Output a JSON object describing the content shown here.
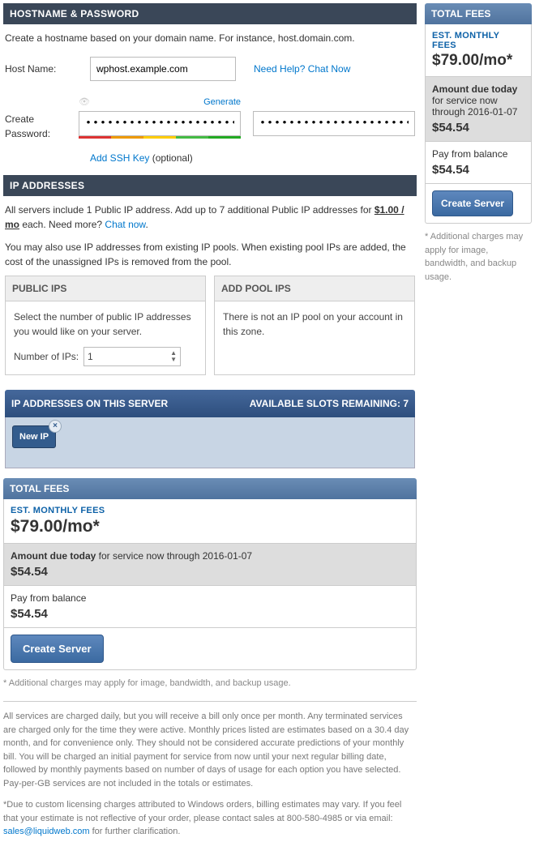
{
  "hostname_section": {
    "header": "HOSTNAME & PASSWORD",
    "intro": "Create a hostname based on your domain name. For instance, host.domain.com.",
    "host_label": "Host Name:",
    "host_value": "wphost.example.com",
    "need_help": "Need Help? Chat Now",
    "pw_label": "Create Password:",
    "generate": "Generate",
    "pw_value": "••••••••••••••••••••••••••",
    "pw_confirm_value": "••••••••••••••••••••••••••",
    "add_ssh": "Add SSH Key",
    "add_ssh_optional": " (optional)"
  },
  "ip_section": {
    "header": "IP ADDRESSES",
    "line1_a": "All servers include 1 Public IP address. Add up to 7 additional Public IP addresses for ",
    "line1_price": "$1.00 / mo",
    "line1_b": " each. Need more? ",
    "chat_now": "Chat now",
    "line2": "You may also use IP addresses from existing IP pools. When existing pool IPs are added, the cost of the unassigned IPs is removed from the pool.",
    "public_ips_head": "PUBLIC IPS",
    "public_ips_text": "Select the number of public IP addresses you would like on your server.",
    "num_ips_label": "Number of IPs:",
    "num_ips_value": "1",
    "pool_ips_head": "ADD POOL IPS",
    "pool_ips_text": "There is not an IP pool on your account in this zone.",
    "server_ips_head": "IP ADDRESSES ON THIS SERVER",
    "slots_remaining": "AVAILABLE SLOTS REMAINING: 7",
    "new_ip_chip": "New IP"
  },
  "fees": {
    "header": "TOTAL FEES",
    "est_label": "EST. MONTHLY FEES",
    "est_price": "$79.00/mo*",
    "due_label_a": "Amount due today",
    "due_label_b": " for service now through 2016-01-07",
    "due_amount": "$54.54",
    "pay_label": "Pay from balance",
    "pay_amount": "$54.54",
    "create_btn": "Create Server",
    "extra_note": "* Additional charges may apply for image, bandwidth, and backup usage."
  },
  "legal": {
    "p1": "All services are charged daily, but you will receive a bill only once per month. Any terminated services are charged only for the time they were active. Monthly prices listed are estimates based on a 30.4 day month, and for convenience only. They should not be considered accurate predictions of your monthly bill. You will be charged an initial payment for service from now until your next regular billing date, followed by monthly payments based on number of days of usage for each option you have selected. Pay-per-GB services are not included in the totals or estimates.",
    "p2_a": "*Due to custom licensing charges attributed to Windows orders, billing estimates may vary. If you feel that your estimate is not reflective of your order, please contact sales at 800-580-4985 or via email: ",
    "p2_email": "sales@liquidweb.com",
    "p2_b": " for further clarification."
  }
}
